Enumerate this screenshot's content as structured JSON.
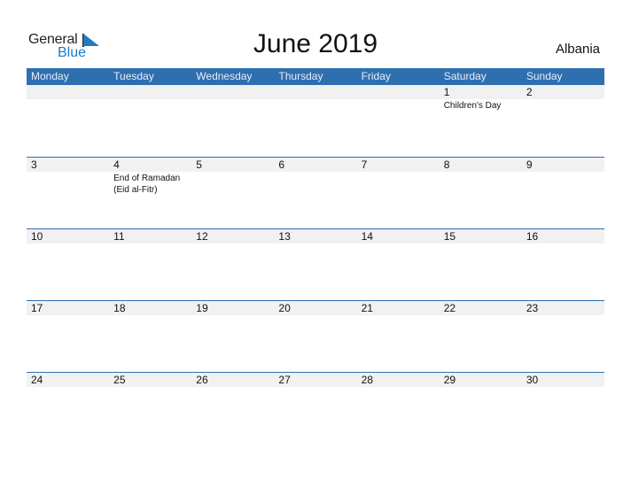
{
  "logo": {
    "word1": "General",
    "word2": "Blue"
  },
  "title": "June 2019",
  "country": "Albania",
  "colors": {
    "header_bg": "#2e6fb0",
    "band_bg": "#f1f1f1",
    "brand_blue": "#1f7ac3"
  },
  "weekdays": [
    "Monday",
    "Tuesday",
    "Wednesday",
    "Thursday",
    "Friday",
    "Saturday",
    "Sunday"
  ],
  "weeks": [
    [
      {
        "day": "",
        "event": ""
      },
      {
        "day": "",
        "event": ""
      },
      {
        "day": "",
        "event": ""
      },
      {
        "day": "",
        "event": ""
      },
      {
        "day": "",
        "event": ""
      },
      {
        "day": "1",
        "event": "Children's Day"
      },
      {
        "day": "2",
        "event": ""
      }
    ],
    [
      {
        "day": "3",
        "event": ""
      },
      {
        "day": "4",
        "event": "End of Ramadan (Eid al-Fitr)"
      },
      {
        "day": "5",
        "event": ""
      },
      {
        "day": "6",
        "event": ""
      },
      {
        "day": "7",
        "event": ""
      },
      {
        "day": "8",
        "event": ""
      },
      {
        "day": "9",
        "event": ""
      }
    ],
    [
      {
        "day": "10",
        "event": ""
      },
      {
        "day": "11",
        "event": ""
      },
      {
        "day": "12",
        "event": ""
      },
      {
        "day": "13",
        "event": ""
      },
      {
        "day": "14",
        "event": ""
      },
      {
        "day": "15",
        "event": ""
      },
      {
        "day": "16",
        "event": ""
      }
    ],
    [
      {
        "day": "17",
        "event": ""
      },
      {
        "day": "18",
        "event": ""
      },
      {
        "day": "19",
        "event": ""
      },
      {
        "day": "20",
        "event": ""
      },
      {
        "day": "21",
        "event": ""
      },
      {
        "day": "22",
        "event": ""
      },
      {
        "day": "23",
        "event": ""
      }
    ],
    [
      {
        "day": "24",
        "event": ""
      },
      {
        "day": "25",
        "event": ""
      },
      {
        "day": "26",
        "event": ""
      },
      {
        "day": "27",
        "event": ""
      },
      {
        "day": "28",
        "event": ""
      },
      {
        "day": "29",
        "event": ""
      },
      {
        "day": "30",
        "event": ""
      }
    ]
  ]
}
